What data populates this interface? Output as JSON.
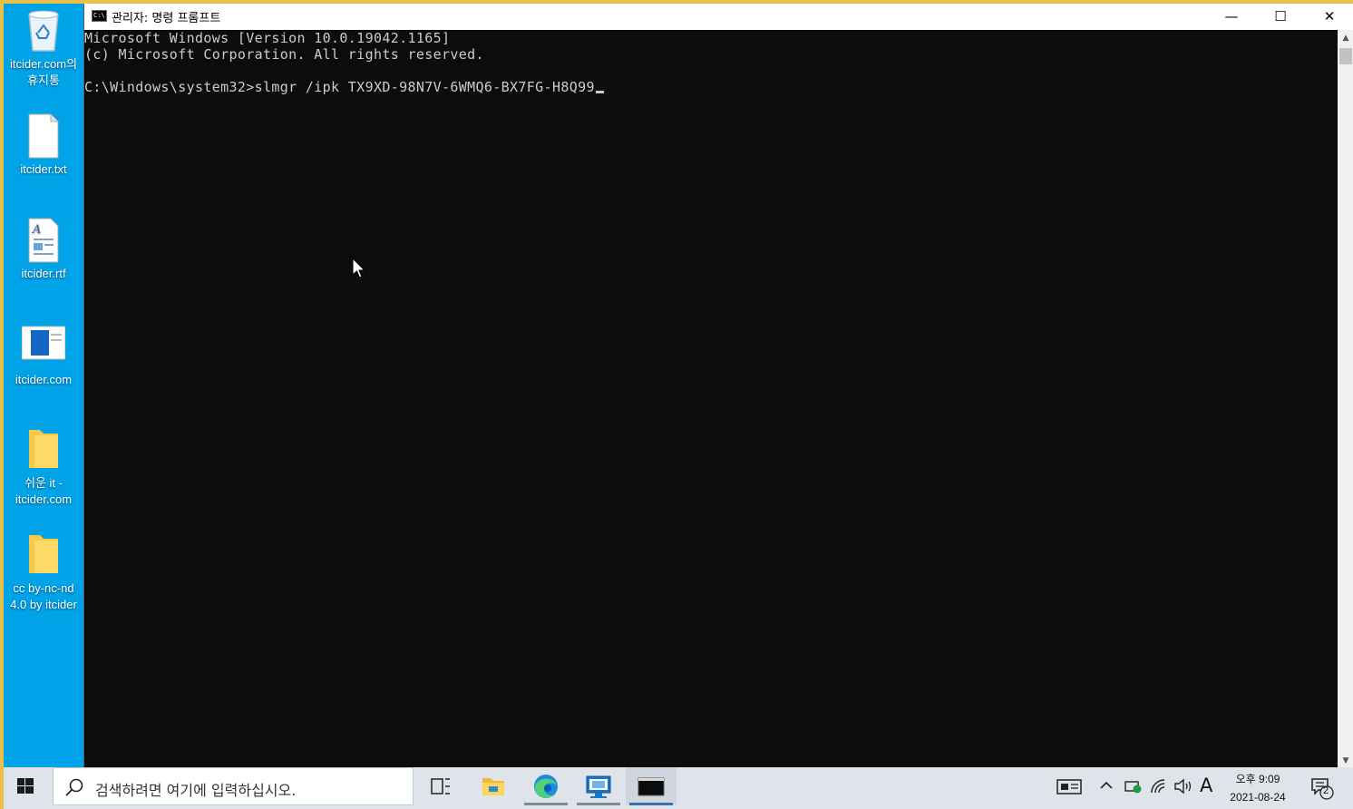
{
  "desktop": {
    "icons": [
      {
        "label": "itcider.com의\n휴지통",
        "icon": "recycle-bin-icon"
      },
      {
        "label": "itcider.txt",
        "icon": "text-file-icon"
      },
      {
        "label": "itcider.rtf",
        "icon": "rtf-file-icon"
      },
      {
        "label": "itcider.com",
        "icon": "shortcut-icon"
      },
      {
        "label": "쉬운 it -\nitcider.com",
        "icon": "folder-icon"
      },
      {
        "label": "cc by-nc-nd\n4.0 by itcider",
        "icon": "folder-icon"
      }
    ]
  },
  "window": {
    "title": "관리자: 명령 프롬프트",
    "icon_label": "C:\\",
    "controls": {
      "minimize": "—",
      "maximize": "☐",
      "close": "✕"
    }
  },
  "console": {
    "lines": [
      "Microsoft Windows [Version 10.0.19042.1165]",
      "(c) Microsoft Corporation. All rights reserved.",
      "",
      "C:\\Windows\\system32>slmgr /ipk TX9XD-98N7V-6WMQ6-BX7FG-H8Q99"
    ]
  },
  "taskbar": {
    "search_placeholder": "검색하려면 여기에 입력하십시오.",
    "apps": [
      {
        "name": "task-view"
      },
      {
        "name": "file-explorer"
      },
      {
        "name": "edge"
      },
      {
        "name": "remote-desktop"
      },
      {
        "name": "command-prompt"
      }
    ],
    "tray": {
      "ime": "A",
      "time": "오후 9:09",
      "date": "2021-08-24",
      "notification_count": "2"
    }
  },
  "colors": {
    "desktop": "#00a2e8",
    "console_bg": "#0c0c0c",
    "console_fg": "#cccccc",
    "taskbar": "#dfe3ea",
    "border": "#e8c04a"
  }
}
